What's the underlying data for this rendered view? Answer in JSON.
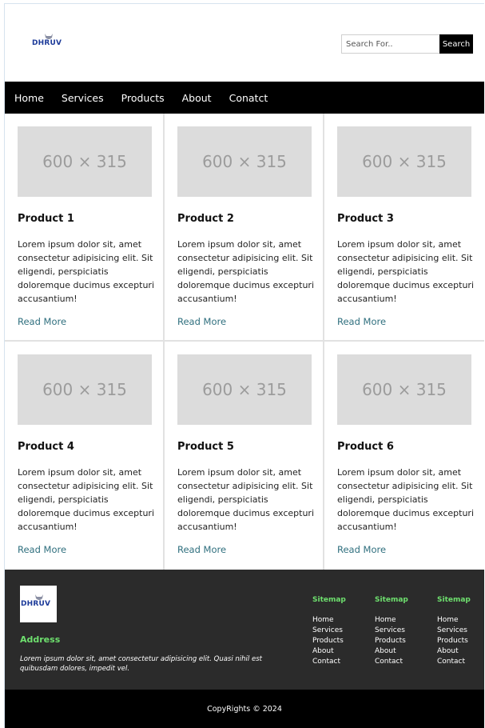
{
  "header": {
    "logo_text": "DHRUV",
    "search": {
      "placeholder": "Search For..",
      "button_label": "Search"
    }
  },
  "nav": {
    "items": [
      {
        "label": "Home"
      },
      {
        "label": "Services"
      },
      {
        "label": "Products"
      },
      {
        "label": "About"
      },
      {
        "label": "Conatct"
      }
    ]
  },
  "products": [
    {
      "image_label": "600 × 315",
      "title": "Product 1",
      "description": "Lorem ipsum dolor sit, amet consectetur adipisicing elit. Sit eligendi, perspiciatis doloremque ducimus excepturi accusantium!",
      "link": "Read More"
    },
    {
      "image_label": "600 × 315",
      "title": "Product 2",
      "description": "Lorem ipsum dolor sit, amet consectetur adipisicing elit. Sit eligendi, perspiciatis doloremque ducimus excepturi accusantium!",
      "link": "Read More"
    },
    {
      "image_label": "600 × 315",
      "title": "Product 3",
      "description": "Lorem ipsum dolor sit, amet consectetur adipisicing elit. Sit eligendi, perspiciatis doloremque ducimus excepturi accusantium!",
      "link": "Read More"
    },
    {
      "image_label": "600 × 315",
      "title": "Product 4",
      "description": "Lorem ipsum dolor sit, amet consectetur adipisicing elit. Sit eligendi, perspiciatis doloremque ducimus excepturi accusantium!",
      "link": "Read More"
    },
    {
      "image_label": "600 × 315",
      "title": "Product 5",
      "description": "Lorem ipsum dolor sit, amet consectetur adipisicing elit. Sit eligendi, perspiciatis doloremque ducimus excepturi accusantium!",
      "link": "Read More"
    },
    {
      "image_label": "600 × 315",
      "title": "Product 6",
      "description": "Lorem ipsum dolor sit, amet consectetur adipisicing elit. Sit eligendi, perspiciatis doloremque ducimus excepturi accusantium!",
      "link": "Read More"
    }
  ],
  "footer": {
    "logo_text": "DHRUV",
    "address_title": "Address",
    "address_text": "Lorem ipsum dolor sit, amet consectetur adipisicing elit. Quasi nihil est quibusdam dolores, impedit vel.",
    "columns": [
      {
        "title": "Sitemap",
        "links": [
          "Home",
          "Services",
          "Products",
          "About",
          "Contact"
        ]
      },
      {
        "title": "Sitemap",
        "links": [
          "Home",
          "Services",
          "Products",
          "About",
          "Contact"
        ]
      },
      {
        "title": "Sitemap",
        "links": [
          "Home",
          "Services",
          "Products",
          "About",
          "Contact"
        ]
      }
    ]
  },
  "copyright": "CopyRights © 2024",
  "colors": {
    "nav_bg": "#000000",
    "footer_bg": "#2b2b2b",
    "footer_accent": "#6ee06e",
    "link": "#2f6f7e",
    "placeholder_bg": "#dcdcdc"
  }
}
